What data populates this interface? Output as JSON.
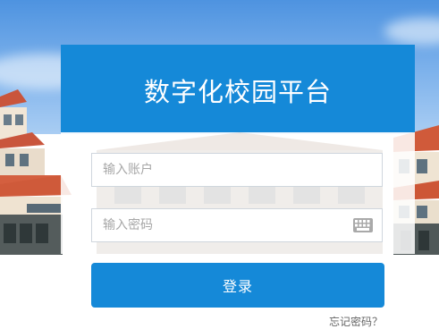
{
  "login": {
    "title": "数字化校园平台",
    "username_placeholder": "输入账户",
    "password_placeholder": "输入密码",
    "submit_label": "登录",
    "forgot_label": "忘记密码？",
    "keyboard_icon": "keyboard-icon"
  },
  "colors": {
    "accent": "#1589d8",
    "sky": "#4e93e0"
  }
}
